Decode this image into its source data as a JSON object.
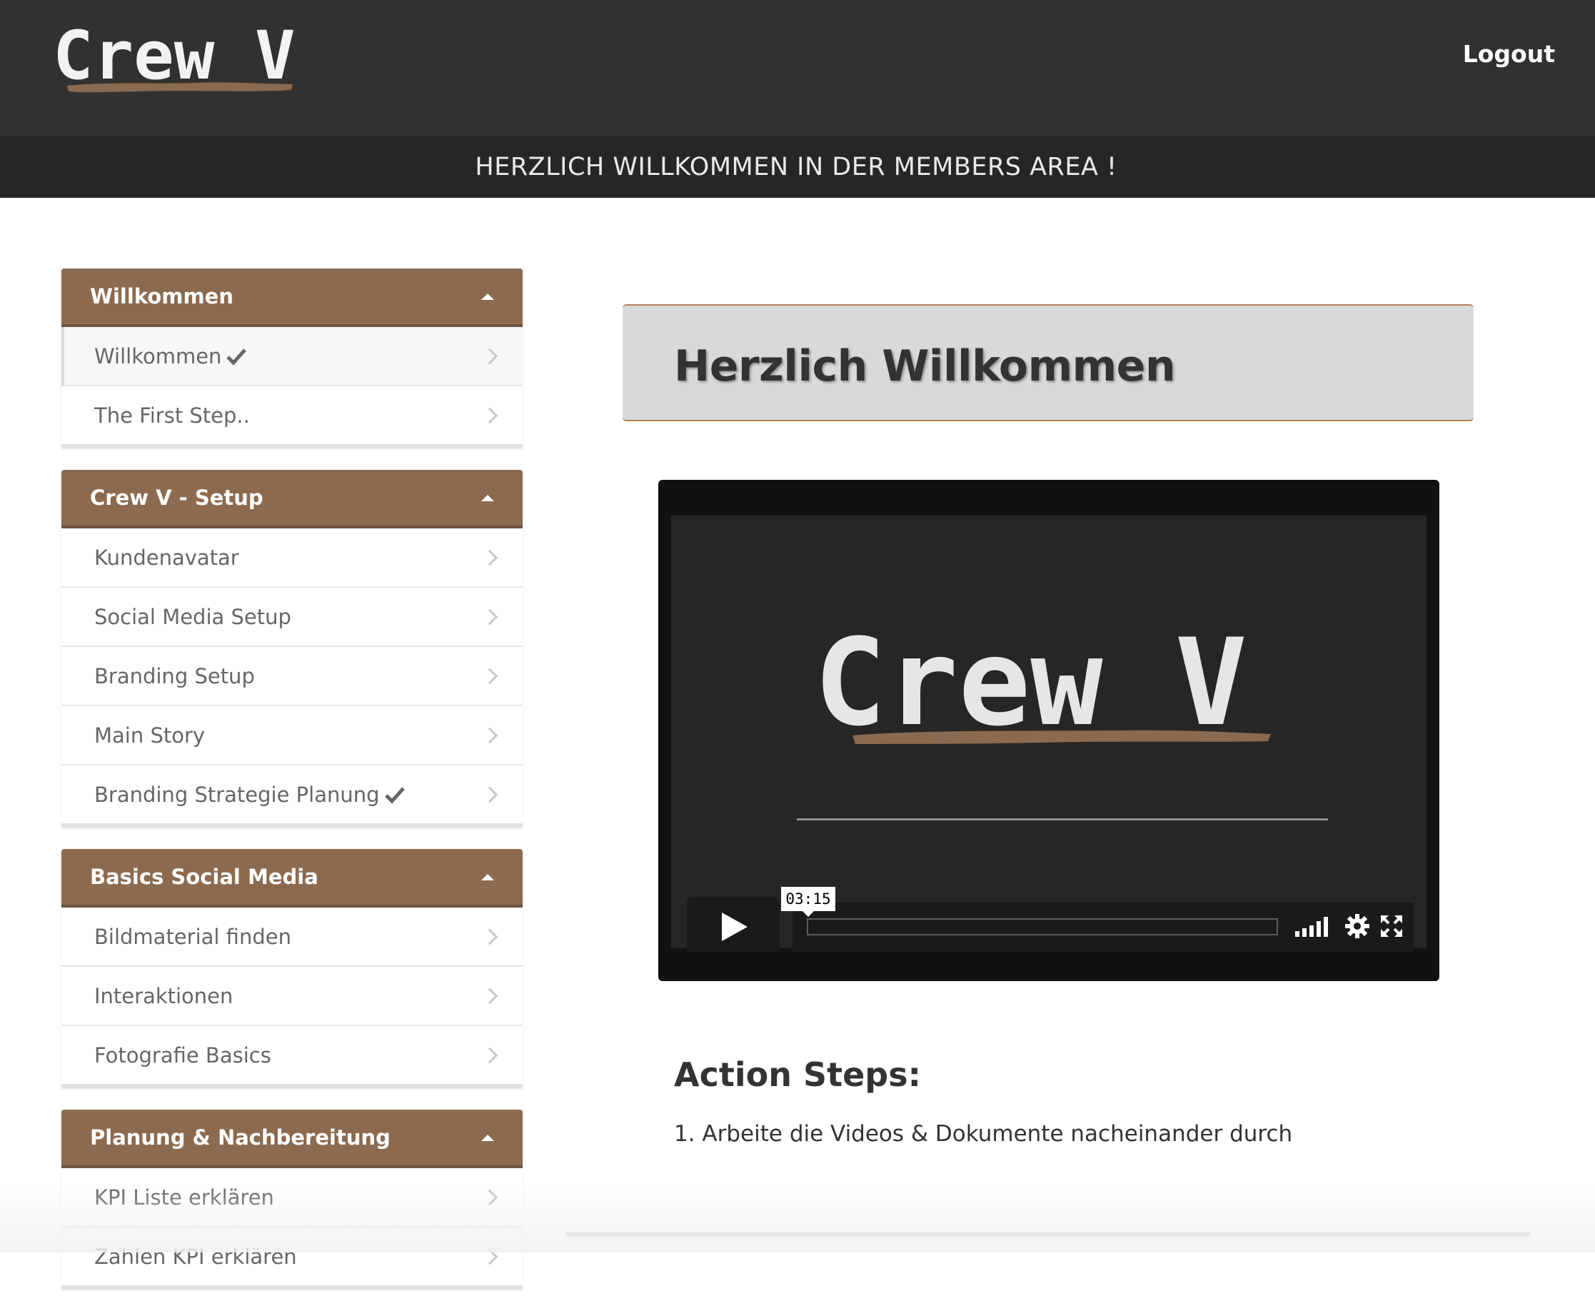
{
  "header": {
    "logo_text": "Crew V",
    "logout_label": "Logout",
    "banner_text": "HERZLICH WILLKOMMEN IN DER MEMBERS AREA !",
    "brand_color": "#8b6a4f"
  },
  "sidebar": {
    "modules": [
      {
        "title": "Willkommen",
        "lessons": [
          {
            "label": "Willkommen",
            "completed": true
          },
          {
            "label": "The First Step..",
            "completed": false
          }
        ]
      },
      {
        "title": "Crew V - Setup",
        "lessons": [
          {
            "label": "Kundenavatar",
            "completed": false
          },
          {
            "label": "Social Media Setup",
            "completed": false
          },
          {
            "label": "Branding Setup",
            "completed": false
          },
          {
            "label": "Main Story",
            "completed": false
          },
          {
            "label": "Branding Strategie Planung",
            "completed": true
          }
        ]
      },
      {
        "title": "Basics Social Media",
        "lessons": [
          {
            "label": "Bildmaterial finden",
            "completed": false
          },
          {
            "label": "Interaktionen",
            "completed": false
          },
          {
            "label": "Fotografie Basics",
            "completed": false
          }
        ]
      },
      {
        "title": "Planung & Nachbereitung",
        "lessons": [
          {
            "label": "KPI Liste erklären",
            "completed": false
          },
          {
            "label": "Zahlen KPI erklären",
            "completed": false
          }
        ]
      }
    ]
  },
  "main": {
    "title": "Herzlich Willkommen",
    "video": {
      "logo_text": "Crew V",
      "duration": "03:15"
    },
    "action_steps_title": "Action Steps:",
    "action_steps_text": "1. Arbeite die Videos & Dokumente nacheinander durch"
  }
}
